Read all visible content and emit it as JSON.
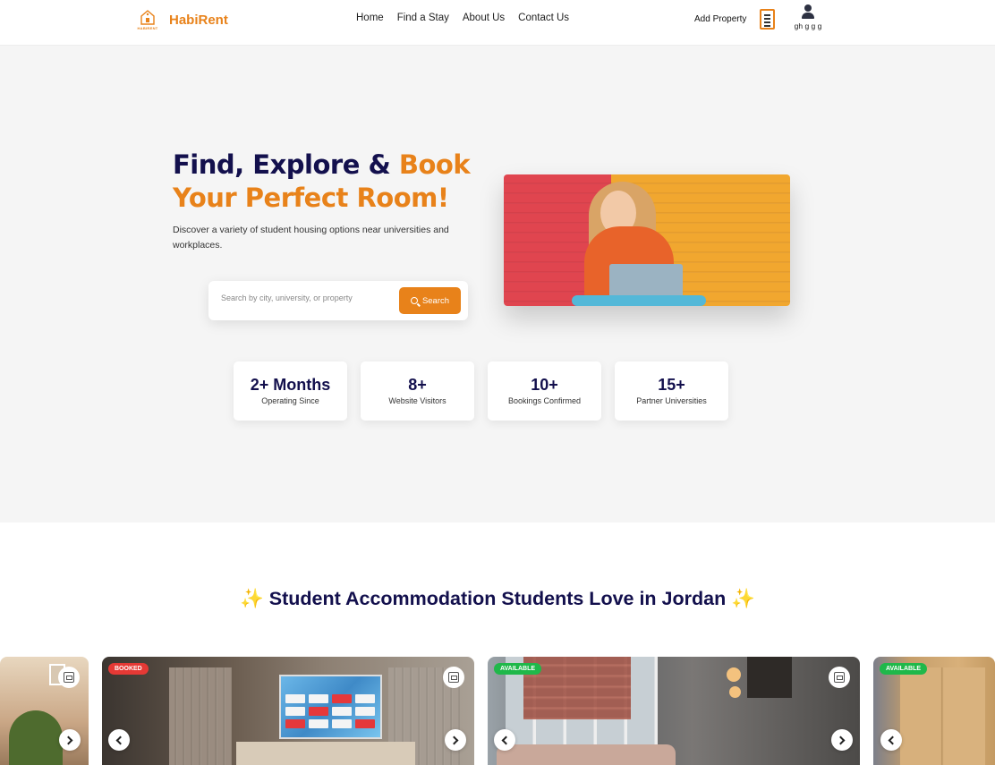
{
  "brand": {
    "name": "HabiRent",
    "logo_text": "HABIRENT",
    "accent_color": "#e8821a",
    "navy_color": "#13104d"
  },
  "nav": {
    "items": [
      "Home",
      "Find a Stay",
      "About Us",
      "Contact Us"
    ],
    "add_property": "Add Property",
    "user_name": "gh g g g",
    "icons": [
      "document-icon",
      "user-icon"
    ]
  },
  "hero": {
    "title_part1": "Find, Explore &",
    "title_part2": "Book",
    "title_part3": "Your Perfect Room!",
    "subtitle": "Discover a variety of student housing options near universities and workplaces.",
    "search_placeholder": "Search by city, university, or property",
    "search_button": "Search"
  },
  "stats": [
    {
      "value": "2+ Months",
      "label": "Operating Since"
    },
    {
      "value": "8+",
      "label": "Website Visitors"
    },
    {
      "value": "10+",
      "label": "Bookings Confirmed"
    },
    {
      "value": "15+",
      "label": "Partner Universities"
    }
  ],
  "section": {
    "title": "Student Accommodation Students Love in Jordan",
    "sparkle": "✨"
  },
  "cards": [
    {
      "badge": ""
    },
    {
      "badge": "BOOKED"
    },
    {
      "badge": "AVAILABLE"
    },
    {
      "badge": "AVAILABLE"
    }
  ],
  "colors": {
    "booked": "#e53935",
    "available": "#1fb84a",
    "hero_bg": "#f5f5f5"
  }
}
